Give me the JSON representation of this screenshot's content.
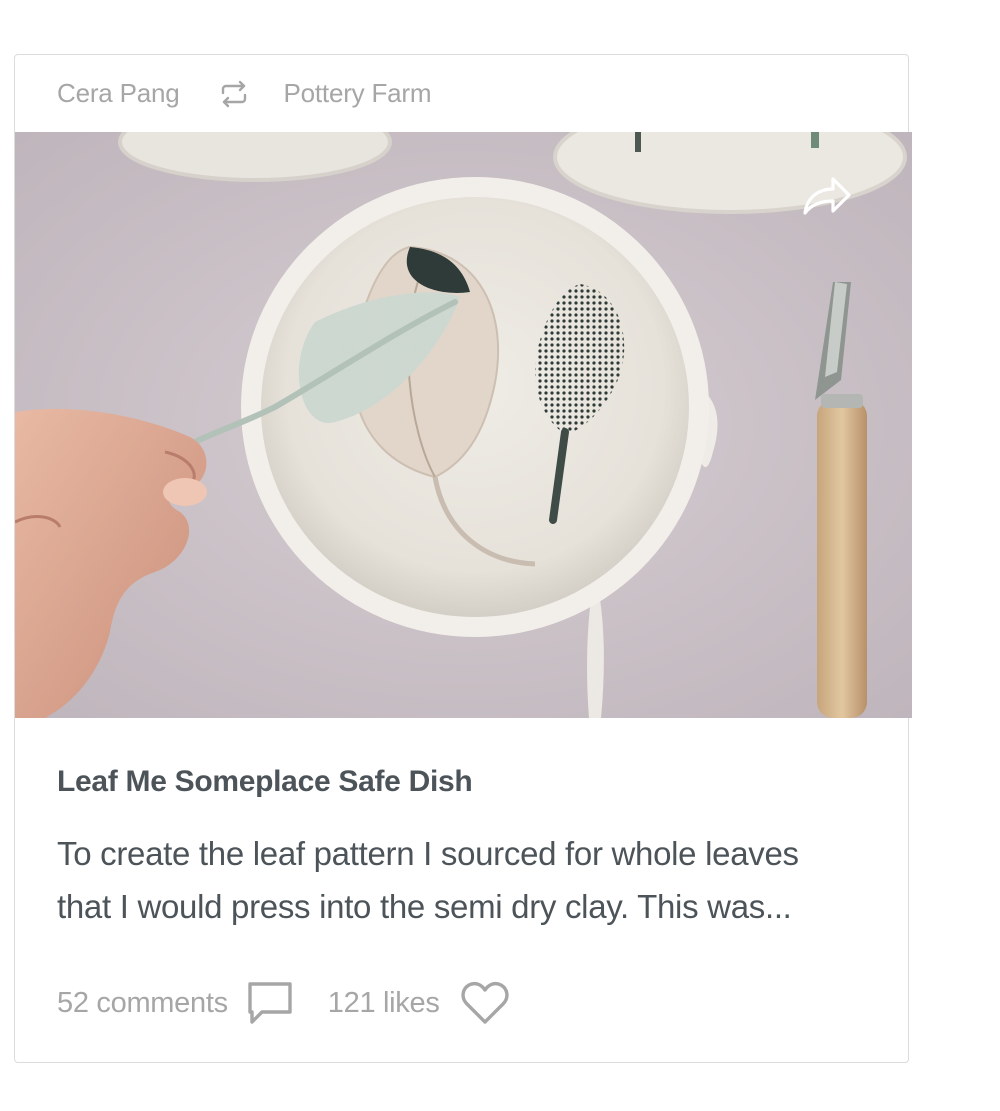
{
  "header": {
    "author": "Cera Pang",
    "repost_icon": "repost-icon",
    "shop": "Pottery Farm"
  },
  "photo": {
    "alt": "Hand pressing a sage leaf into a white clay dish with leaf imprints",
    "share_icon": "share-arrow-icon"
  },
  "post": {
    "title": "Leaf Me Someplace Safe Dish",
    "description_line1": "To create the leaf pattern I sourced for whole leaves",
    "description_line2": "that I would press into the semi dry clay. This was..."
  },
  "footer": {
    "comments": "52 comments",
    "comment_icon": "comment-icon",
    "likes": "121 likes",
    "heart_icon": "heart-icon"
  },
  "colors": {
    "text_primary": "#4c5459",
    "text_muted": "#a6a6a6",
    "border": "#dcdcdc"
  }
}
